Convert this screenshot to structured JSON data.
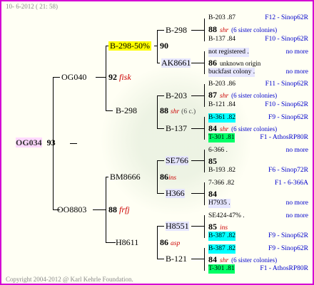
{
  "header": {
    "date": "10-  6-2012 ( 21: 58)"
  },
  "footer": {
    "copyright": "Copyright 2004-2012 @ Karl Kehrle Foundation."
  },
  "root": {
    "name": "OG034",
    "year": "93"
  },
  "gen1": {
    "top": {
      "name": "OG040",
      "year": "92",
      "note": "fisk"
    },
    "bottom": {
      "name": "OO8803",
      "year": "88",
      "note": "frfj"
    }
  },
  "gen2": {
    "a": {
      "name": "B-298-50%",
      "year": "90"
    },
    "b": {
      "name": "B-298",
      "year": "88",
      "note": "shr",
      "extra": "(6 c.)"
    },
    "c": {
      "name": "BM8666",
      "year": "86",
      "note": "ins"
    },
    "d": {
      "name": "H8611",
      "year": "86",
      "note": "asp"
    }
  },
  "gen3": {
    "a1": {
      "name": "B-298"
    },
    "a2": {
      "name": "AK8661"
    },
    "b1": {
      "name": "B-203"
    },
    "b2": {
      "name": "B-137"
    },
    "c1": {
      "name": "SE766"
    },
    "c2": {
      "name": "H366"
    },
    "d1": {
      "name": "H8551"
    },
    "d2": {
      "name": "B-121"
    }
  },
  "gen4": [
    {
      "id": "B-203 .87",
      "breeder": "F12 - Sinop62R"
    },
    {
      "year": "88",
      "note": "shr",
      "extra": "(6 sister colonies)"
    },
    {
      "id": "B-137 .84",
      "breeder": "F10 - Sinop62R"
    },
    {
      "id": "not registered .",
      "breeder": "no more"
    },
    {
      "year": "86",
      "extra": "unknown origin"
    },
    {
      "id": "buckfast colony .",
      "breeder": "no more"
    },
    {
      "id": "B-203 .86",
      "breeder": "F11 - Sinop62R"
    },
    {
      "year": "87",
      "note": "shr",
      "extra": "(6 sister colonies)"
    },
    {
      "id": "B-121 .84",
      "breeder": "F10 - Sinop62R"
    },
    {
      "id": "B-361 .82",
      "breeder": "F9 - Sinop62R"
    },
    {
      "year": "84",
      "note": "shr",
      "extra": "(6 sister colonies)"
    },
    {
      "id": "T-301 .81",
      "breeder": "F1 - AthosRP80R"
    },
    {
      "id": "6-366 .",
      "breeder": "no more"
    },
    {
      "year": "85"
    },
    {
      "id": "B-193 .82",
      "breeder": "F6 - Sinop72R"
    },
    {
      "id": "7-366 .82",
      "breeder": "F1 - 6-366A"
    },
    {
      "year": "84"
    },
    {
      "id": "H7935 .",
      "breeder": "no more"
    },
    {
      "id": "SE424-47% .",
      "breeder": "no more"
    },
    {
      "year": "85",
      "note": "ins"
    },
    {
      "id": "B-387 .82",
      "breeder": "F9 - Sinop62R"
    },
    {
      "id": "B-387 .82",
      "breeder": "F9 - Sinop62R"
    },
    {
      "year": "84",
      "note": "shr",
      "extra": "(6 sister colonies)"
    },
    {
      "id": "T-301 .81",
      "breeder": "F1 - AthosRP80R"
    }
  ]
}
